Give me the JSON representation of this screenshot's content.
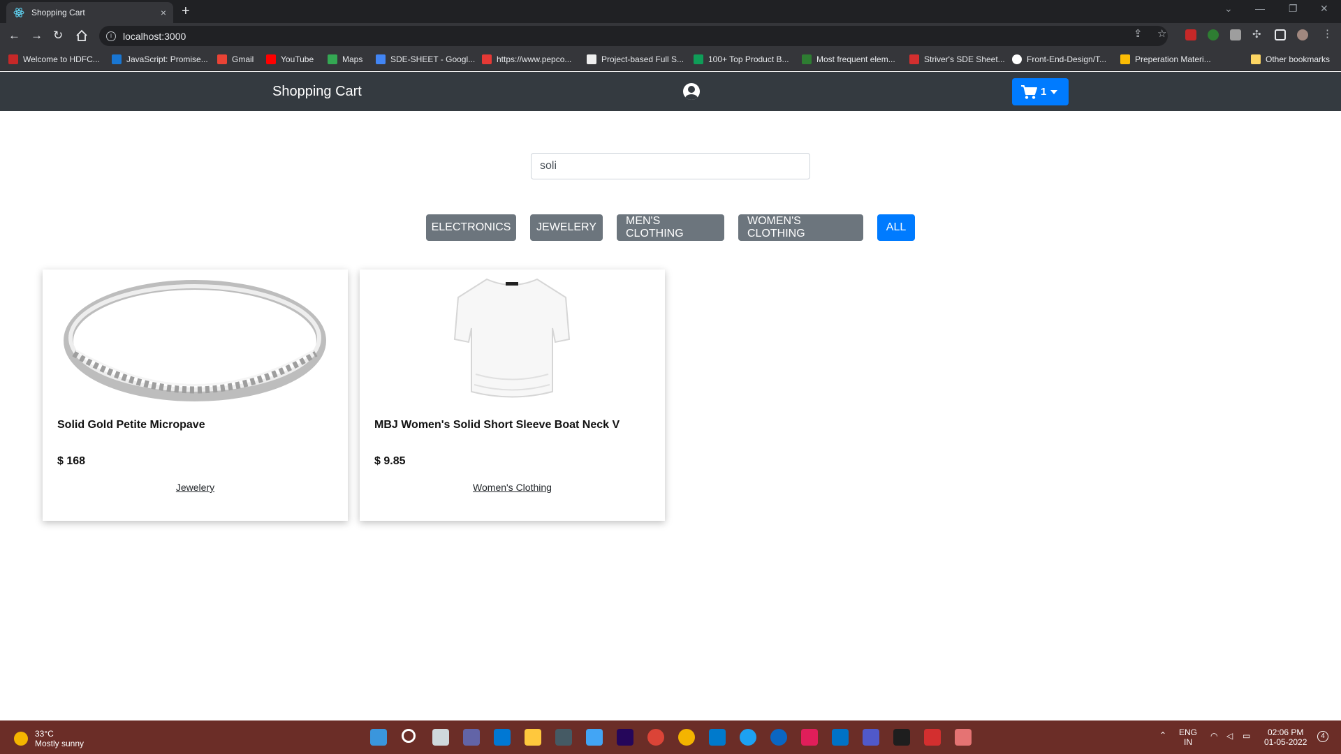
{
  "browser": {
    "tab_title": "Shopping Cart",
    "tab_close": "×",
    "new_tab": "+",
    "url": "localhost:3000",
    "bookmarks": [
      {
        "label": "Welcome to HDFC...",
        "color": "#c62828"
      },
      {
        "label": "JavaScript: Promise...",
        "color": "#1976d2"
      },
      {
        "label": "Gmail",
        "color": "#ea4335"
      },
      {
        "label": "YouTube",
        "color": "#ff0000"
      },
      {
        "label": "Maps",
        "color": "#34a853"
      },
      {
        "label": "SDE-SHEET - Googl...",
        "color": "#4285f4"
      },
      {
        "label": "https://www.pepco...",
        "color": "#e53935"
      },
      {
        "label": "Project-based Full S...",
        "color": "#eeeeee"
      },
      {
        "label": "100+ Top Product B...",
        "color": "#0f9d58"
      },
      {
        "label": "Most frequent elem...",
        "color": "#2e7d32"
      },
      {
        "label": "Striver's SDE Sheet...",
        "color": "#d32f2f"
      },
      {
        "label": "Front-End-Design/T...",
        "color": "#ffffff"
      },
      {
        "label": "Preperation Materi...",
        "color": "#fbbc04"
      }
    ],
    "other_bookmarks": "Other bookmarks"
  },
  "navbar": {
    "brand": "Shopping Cart",
    "cart_count": "1"
  },
  "search": {
    "value": "soli"
  },
  "categories": [
    {
      "label": "ELECTRONICS",
      "active": false
    },
    {
      "label": "JEWELERY",
      "active": false
    },
    {
      "label": "MEN'S CLOTHING",
      "active": false
    },
    {
      "label": "WOMEN'S CLOTHING",
      "active": false
    },
    {
      "label": "ALL",
      "active": true
    }
  ],
  "products": [
    {
      "name": "Solid Gold Petite Micropave",
      "price": "$ 168",
      "category": "Jewelery"
    },
    {
      "name": "MBJ Women's Solid Short Sleeve Boat Neck V",
      "price": "$ 9.85",
      "category": "Women's Clothing"
    }
  ],
  "taskbar": {
    "temperature": "33°C",
    "weather": "Mostly sunny",
    "lang_top": "ENG",
    "lang_bottom": "IN",
    "time": "02:06 PM",
    "date": "01-05-2022",
    "notifications": "4"
  },
  "colors": {
    "navbar": "#343a40",
    "primary": "#007bff",
    "secondary": "#6c757d"
  }
}
